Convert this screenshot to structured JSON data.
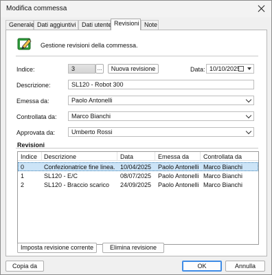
{
  "window": {
    "title": "Modifica commessa"
  },
  "tabs": [
    {
      "label": "Generale"
    },
    {
      "label": "Dati aggiuntivi"
    },
    {
      "label": "Dati utente"
    },
    {
      "label": "Revisioni"
    },
    {
      "label": "Note"
    }
  ],
  "active_tab": "Revisioni",
  "header": {
    "text": "Gestione revisioni della commessa."
  },
  "form": {
    "indice_label": "Indice:",
    "indice_value": "3",
    "indice_button": "...",
    "nuova_revisione": "Nuova revisione",
    "data_label": "Data:",
    "data_value": "10/10/2025",
    "descrizione_label": "Descrizione:",
    "descrizione_value": "SL120 - Robot 300",
    "emessa_label": "Emessa da:",
    "emessa_value": "Paolo Antonelli",
    "controllata_label": "Controllata da:",
    "controllata_value": "Marco Bianchi",
    "approvata_label": "Approvata da:",
    "approvata_value": "Umberto Rossi"
  },
  "revisioni": {
    "title": "Revisioni",
    "columns": [
      "Indice",
      "Descrizione",
      "Data",
      "Emessa da",
      "Controllata da"
    ],
    "rows": [
      {
        "indice": "0",
        "descrizione": "Confezionatrice fine linea...",
        "data": "10/04/2025",
        "emessa": "Paolo Antonelli",
        "controllata": "Marco Bianchi"
      },
      {
        "indice": "1",
        "descrizione": "SL120 - E/C",
        "data": "08/07/2025",
        "emessa": "Paolo Antonelli",
        "controllata": "Marco Bianchi"
      },
      {
        "indice": "2",
        "descrizione": "SL120 - Braccio scarico",
        "data": "24/09/2025",
        "emessa": "Paolo Antonelli",
        "controllata": "Marco Bianchi"
      }
    ],
    "selected_row": 0
  },
  "buttons": {
    "imposta": "Imposta revisione corrente",
    "elimina": "Elimina revisione",
    "copia": "Copia da",
    "ok": "OK",
    "annulla": "Annulla"
  },
  "colors": {
    "selection": "#cce4f7",
    "accent": "#3d8be6",
    "icon_green": "#2e9a3a"
  }
}
